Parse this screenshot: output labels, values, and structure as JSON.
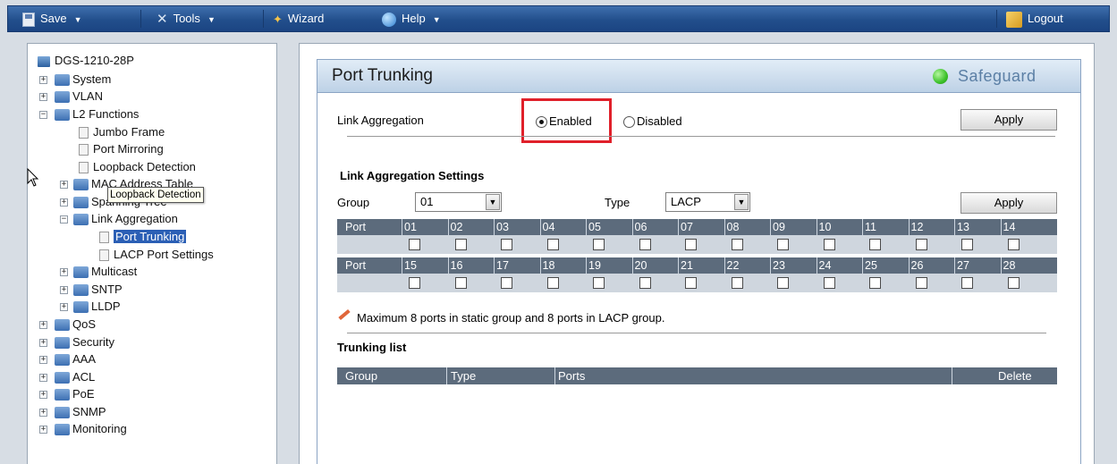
{
  "toolbar": {
    "save": "Save",
    "tools": "Tools",
    "wizard": "Wizard",
    "help": "Help",
    "logout": "Logout"
  },
  "tree": {
    "root": "DGS-1210-28P",
    "system": "System",
    "vlan": "VLAN",
    "l2_functions": "L2 Functions",
    "jumbo_frame": "Jumbo Frame",
    "port_mirroring": "Port Mirroring",
    "loopback_detection": "Loopback Detection",
    "mac_address_table": "MAC Address Table",
    "spanning_tree": "Spanning Tree",
    "link_aggregation": "Link Aggregation",
    "port_trunking": "Port Trunking",
    "lacp_port_settings": "LACP Port Settings",
    "multicast": "Multicast",
    "sntp": "SNTP",
    "lldp": "LLDP",
    "qos": "QoS",
    "security": "Security",
    "aaa": "AAA",
    "acl": "ACL",
    "poe": "PoE",
    "snmp": "SNMP",
    "monitoring": "Monitoring",
    "tooltip": "Loopback Detection"
  },
  "panel": {
    "title": "Port Trunking",
    "safeguard": "Safeguard",
    "link_aggregation_label": "Link Aggregation",
    "enabled": "Enabled",
    "disabled": "Disabled",
    "apply": "Apply",
    "settings_title": "Link Aggregation Settings",
    "group_label": "Group",
    "group_value": "01",
    "type_label": "Type",
    "type_value": "LACP",
    "port_label": "Port",
    "ports_row1": [
      "01",
      "02",
      "03",
      "04",
      "05",
      "06",
      "07",
      "08",
      "09",
      "10",
      "11",
      "12",
      "13",
      "14"
    ],
    "ports_row2": [
      "15",
      "16",
      "17",
      "18",
      "19",
      "20",
      "21",
      "22",
      "23",
      "24",
      "25",
      "26",
      "27",
      "28"
    ],
    "note": "Maximum 8 ports in static group and 8 ports in LACP group.",
    "trunking_list_title": "Trunking list",
    "list_columns": {
      "group": "Group",
      "type": "Type",
      "ports": "Ports",
      "delete": "Delete"
    }
  }
}
